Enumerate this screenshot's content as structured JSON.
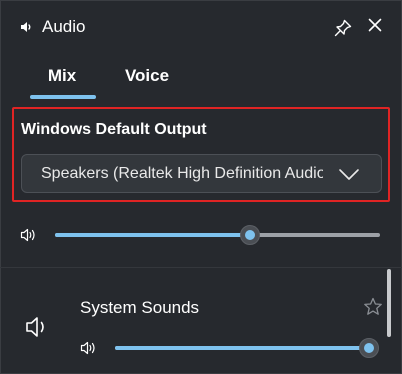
{
  "window": {
    "title": "Audio",
    "title_icon": "speaker-volume-icon",
    "pin_icon": "pin-icon",
    "close_icon": "close-icon"
  },
  "tabs": [
    {
      "label": "Mix",
      "selected": true
    },
    {
      "label": "Voice",
      "selected": false
    }
  ],
  "output": {
    "label": "Windows Default Output",
    "selected_device": "Speakers (Realtek High Definition Audio)",
    "dropdown_icon": "chevron-down-icon"
  },
  "master_volume": {
    "icon": "speaker-volume-icon",
    "level": 0.6
  },
  "apps": [
    {
      "name": "System Sounds",
      "icon": "speaker-icon",
      "favorite_icon": "star-outline-icon",
      "volume_icon": "speaker-volume-icon",
      "level": 1.0
    }
  ],
  "colors": {
    "background": "#26292e",
    "accent": "#7ec2ee",
    "highlight_border": "#e02424",
    "track": "#9da1a7",
    "text": "#ffffff"
  }
}
